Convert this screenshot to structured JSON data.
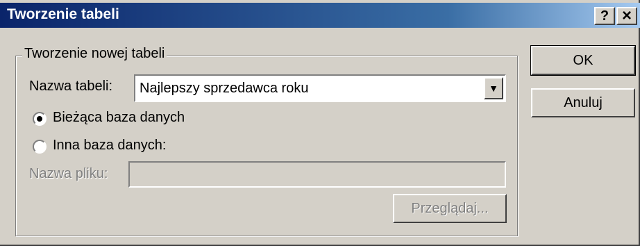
{
  "window": {
    "title": "Tworzenie tabeli",
    "help_button": "?",
    "close_button": "×"
  },
  "group": {
    "legend": "Tworzenie nowej tabeli",
    "table_name_label": "Nazwa tabeli:",
    "table_name_value": "Najlepszy sprzedawca roku",
    "current_db_label": "Bieżąca baza danych",
    "other_db_label": "Inna baza danych:",
    "selected_option": "current_db",
    "file_name_label": "Nazwa pliku:",
    "file_name_value": "",
    "browse_label": "Przeglądaj..."
  },
  "buttons": {
    "ok": "OK",
    "cancel": "Anuluj"
  }
}
